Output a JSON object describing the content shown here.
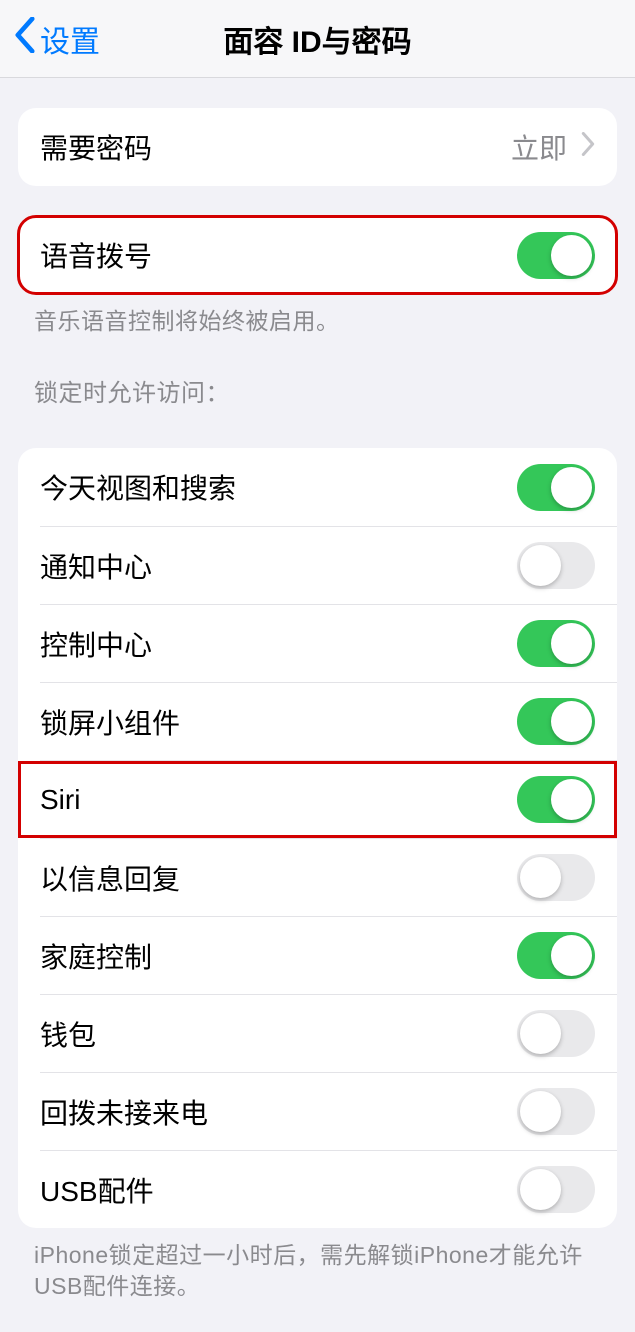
{
  "nav": {
    "back_label": "设置",
    "title": "面容 ID与密码"
  },
  "require_passcode": {
    "label": "需要密码",
    "value": "立即"
  },
  "voice_dial": {
    "label": "语音拨号",
    "on": true,
    "footer": "音乐语音控制将始终被启用。"
  },
  "allow_access_header": "锁定时允许访问：",
  "allow_access": [
    {
      "key": "today",
      "label": "今天视图和搜索",
      "on": true
    },
    {
      "key": "notifications",
      "label": "通知中心",
      "on": false
    },
    {
      "key": "control",
      "label": "控制中心",
      "on": true
    },
    {
      "key": "widgets",
      "label": "锁屏小组件",
      "on": true
    },
    {
      "key": "siri",
      "label": "Siri",
      "on": true,
      "highlighted": true
    },
    {
      "key": "reply",
      "label": "以信息回复",
      "on": false
    },
    {
      "key": "home",
      "label": "家庭控制",
      "on": true
    },
    {
      "key": "wallet",
      "label": "钱包",
      "on": false
    },
    {
      "key": "callback",
      "label": "回拨未接来电",
      "on": false
    },
    {
      "key": "usb",
      "label": "USB配件",
      "on": false
    }
  ],
  "allow_access_footer": "iPhone锁定超过一小时后，需先解锁iPhone才能允许USB配件连接。"
}
